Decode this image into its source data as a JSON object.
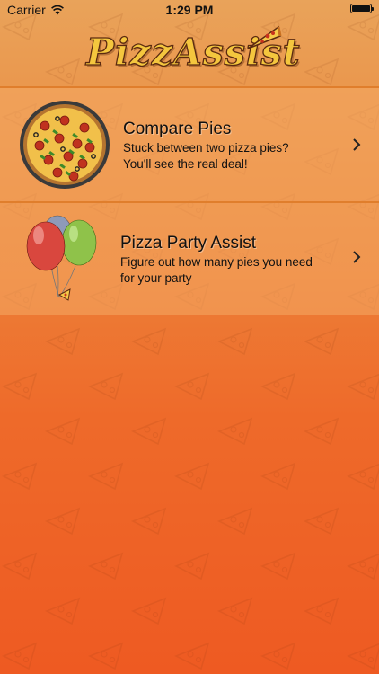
{
  "status_bar": {
    "carrier": "Carrier",
    "time": "1:29 PM",
    "wifi_icon": "wifi-icon",
    "battery_level": 1.0
  },
  "header": {
    "logo_text": "PizzAssist",
    "logo_icon": "pizza-slice-icon"
  },
  "menu": [
    {
      "title": "Compare Pies",
      "description_line_1": "Stuck between two pizza pies?",
      "description_line_2": "You'll see the real deal!",
      "icon": "whole-pizza-icon",
      "accessory": "chevron-right-icon"
    },
    {
      "title": "Pizza Party Assist",
      "description_line_1": "Figure out how many pies you need",
      "description_line_2": "for your party",
      "icon": "balloons-icon",
      "accessory": "chevron-right-icon"
    }
  ],
  "colors": {
    "background_top": "#e9a35a",
    "background_bottom": "#ee5a22",
    "row_background": "#f4aa64",
    "divider": "#e07e2c",
    "logo_fill": "#f4c63e",
    "logo_outline": "#5b2a10"
  }
}
